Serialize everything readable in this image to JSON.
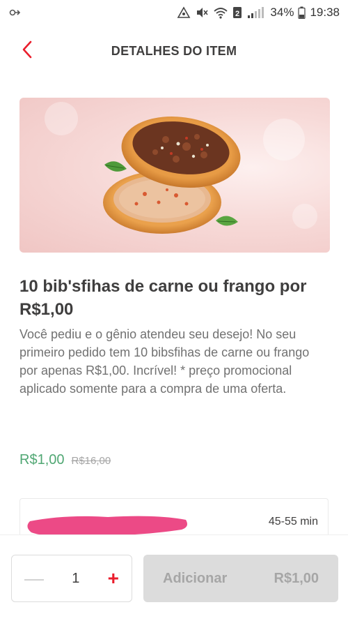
{
  "status_bar": {
    "battery": "34%",
    "time": "19:38",
    "icons": [
      "notification-icon",
      "data-saver-icon",
      "mute-icon",
      "wifi-icon",
      "sim-2-icon",
      "signal-icon",
      "battery-icon"
    ]
  },
  "header": {
    "title": "DETALHES DO ITEM",
    "back_icon": "chevron-left-icon"
  },
  "item": {
    "title": "10 bib'sfihas de carne ou frango por R$1,00",
    "description": "Você pediu e o gênio atendeu seu desejo! No seu primeiro pedido tem 10 bibsfihas de carne ou frango por apenas R$1,00. Incrível! * preço promocional aplicado somente para a compra de uma oferta.",
    "price": "R$1,00",
    "old_price": "R$16,00"
  },
  "restaurant": {
    "eta": "45-55 min"
  },
  "footer": {
    "quantity": "1",
    "minus_symbol": "—",
    "plus_symbol": "+",
    "add_label": "Adicionar",
    "add_price": "R$1,00"
  },
  "colors": {
    "brand_red": "#ea1d2c",
    "price_green": "#50a773",
    "disabled_gray": "#dcdcdc",
    "text_dark": "#3f3e3e",
    "text_muted": "#717171",
    "redaction_pink": "#ec4a86"
  }
}
